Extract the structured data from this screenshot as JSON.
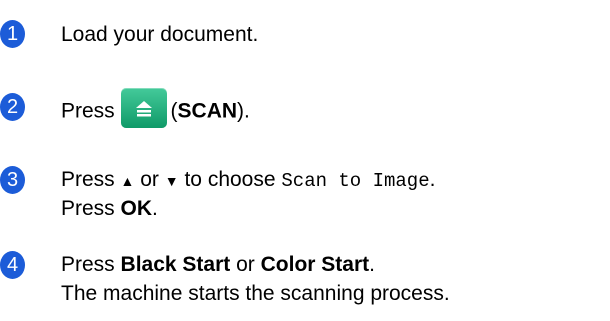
{
  "steps": [
    {
      "number": "1",
      "text": "Load your document."
    },
    {
      "number": "2",
      "press": "Press",
      "open_paren": "(",
      "button_name": "SCAN",
      "close": ")."
    },
    {
      "number": "3",
      "line1_press": "Press",
      "up_arrow": "▲",
      "or": "or",
      "down_arrow": "▼",
      "to_choose": "to choose",
      "option": "Scan to Image",
      "period": ".",
      "line2_press": "Press",
      "ok": "OK",
      "line2_period": "."
    },
    {
      "number": "4",
      "press": "Press",
      "black_start": "Black Start",
      "or": "or",
      "color_start": "Color Start",
      "period": ".",
      "line2": "The machine starts the scanning process."
    }
  ],
  "colors": {
    "badge": "#1c5cd8",
    "scan_key": "#22b07c"
  },
  "icons": {
    "scan_key": "scan-document-icon"
  }
}
